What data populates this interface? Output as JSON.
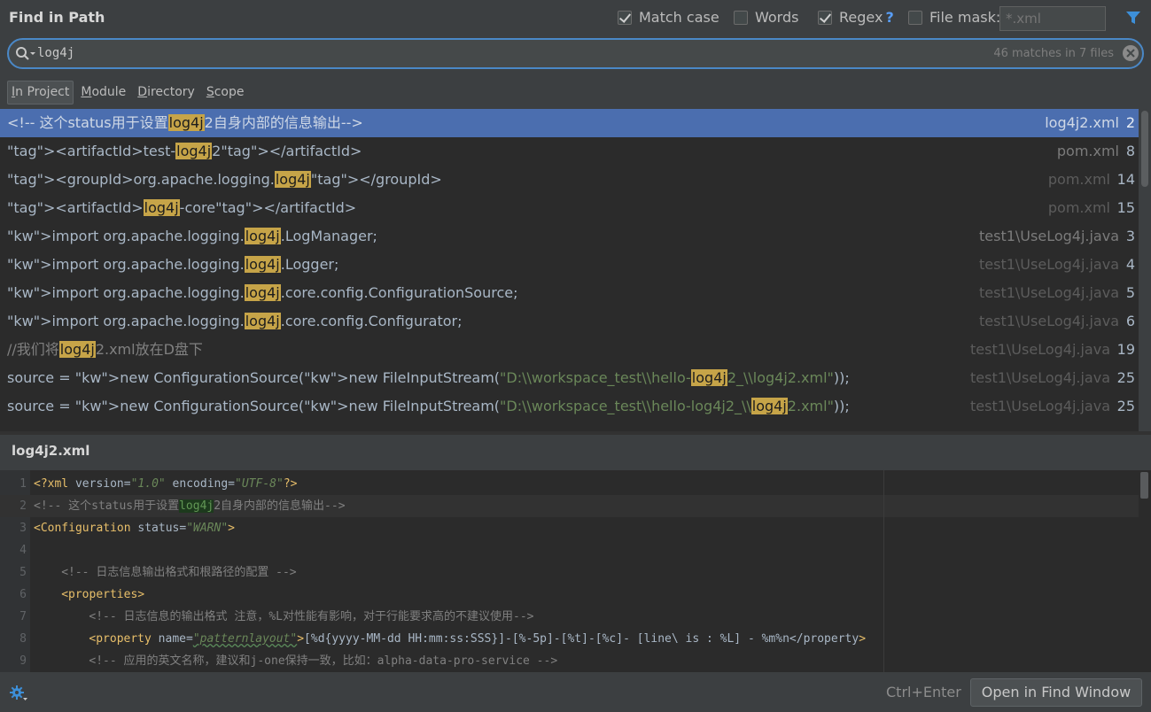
{
  "header": {
    "title": "Find in Path",
    "options": [
      {
        "label": "Match case",
        "checked": true
      },
      {
        "label": "Words",
        "checked": false
      },
      {
        "label": "Regex",
        "checked": true,
        "suffix": "?"
      },
      {
        "label": "File mask:",
        "checked": false
      }
    ],
    "file_mask_placeholder": "*.xml"
  },
  "search": {
    "query": "log4j",
    "match_count": "46 matches in 7 files"
  },
  "scopes": [
    {
      "label": "In Project",
      "active": true
    },
    {
      "label": "Module",
      "active": false
    },
    {
      "label": "Directory",
      "active": false
    },
    {
      "label": "Scope",
      "active": false
    }
  ],
  "results": [
    {
      "text": "<!-- 这个status用于设置log4j2自身内部的信息输出-->",
      "file": "log4j2.xml",
      "line": "2"
    },
    {
      "text": "<artifactId>test-log4j2</artifactId>",
      "file": "pom.xml",
      "line": "8"
    },
    {
      "text": "<groupId>org.apache.logging.log4j</groupId>",
      "file": "pom.xml",
      "line": "14"
    },
    {
      "text": "<artifactId>log4j-core</artifactId>",
      "file": "pom.xml",
      "line": "15"
    },
    {
      "text": "import org.apache.logging.log4j.LogManager;",
      "file": "test1\\UseLog4j.java",
      "line": "3"
    },
    {
      "text": "import org.apache.logging.log4j.Logger;",
      "file": "test1\\UseLog4j.java",
      "line": "4"
    },
    {
      "text": "import org.apache.logging.log4j.core.config.ConfigurationSource;",
      "file": "test1\\UseLog4j.java",
      "line": "5"
    },
    {
      "text": "import org.apache.logging.log4j.core.config.Configurator;",
      "file": "test1\\UseLog4j.java",
      "line": "6"
    },
    {
      "text": "//我们将log4j2.xml放在D盘下",
      "file": "test1\\UseLog4j.java",
      "line": "19"
    },
    {
      "text": "source = new ConfigurationSource(new FileInputStream(\"D:\\\\workspace_test\\\\hello-log4j2_\\\\log4j2.xml\"));",
      "file": "test1\\UseLog4j.java",
      "line": "25"
    },
    {
      "text": "source = new ConfigurationSource(new FileInputStream(\"D:\\\\workspace_test\\\\hello-log4j2_\\\\log4j2.xml\"));",
      "file": "test1\\UseLog4j.java",
      "line": "25"
    }
  ],
  "preview": {
    "file": "log4j2.xml",
    "lines": [
      {
        "n": "1",
        "text": "<?xml version=\"1.0\" encoding=\"UTF-8\"?>"
      },
      {
        "n": "2",
        "text": "<!-- 这个status用于设置log4j2自身内部的信息输出-->"
      },
      {
        "n": "3",
        "text": "<Configuration status=\"WARN\">"
      },
      {
        "n": "4",
        "text": ""
      },
      {
        "n": "5",
        "text": "<!-- 日志信息输出格式和根路径的配置 -->"
      },
      {
        "n": "6",
        "text": "<properties>"
      },
      {
        "n": "7",
        "text": "<!-- 日志信息的输出格式 注意，%L对性能有影响，对于行能要求高的不建议使用-->"
      },
      {
        "n": "8",
        "text": "<property name=\"patternlayout\">[%d{yyyy-MM-dd HH:mm:ss:SSS}]-[%-5p]-[%t]-[%c]- [line\\ is : %L] - %m%n</property>"
      },
      {
        "n": "9",
        "text": "<!-- 应用的英文名称，建议和j-one保持一致，比如：alpha-data-pro-service -->"
      }
    ]
  },
  "footer": {
    "shortcut": "Ctrl+Enter",
    "open_button": "Open in Find Window"
  },
  "colors": {
    "selection": "#4b6eaf",
    "highlight": "#c6a448",
    "accent": "#4a88c7"
  }
}
